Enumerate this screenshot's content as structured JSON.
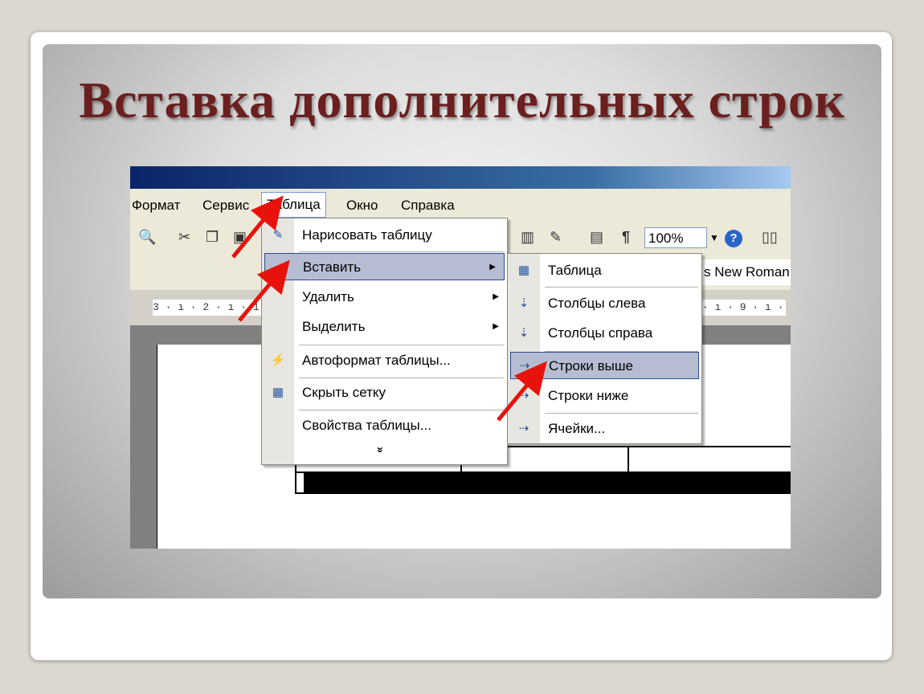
{
  "slide": {
    "title": "Вставка дополнительных строк"
  },
  "menubar": {
    "items": [
      "Формат",
      "Сервис",
      "Таблица",
      "Окно",
      "Справка"
    ]
  },
  "toolbar": {
    "zoom": "100%",
    "pilcrow": "¶",
    "help": "?"
  },
  "format_bar": {
    "font": "s New Roman"
  },
  "ruler": {
    "left_text": "3 · ı · 2 · ı · 1",
    "right_text": "· ı · 9 · ı ·"
  },
  "table_menu": {
    "items": [
      {
        "label": "Нарисовать таблицу",
        "icon": "pencil-table-icon",
        "submenu": false
      },
      {
        "label": "Вставить",
        "icon": "",
        "submenu": true,
        "highlighted": true
      },
      {
        "label": "Удалить",
        "icon": "",
        "submenu": true
      },
      {
        "label": "Выделить",
        "icon": "",
        "submenu": true
      },
      {
        "label": "Автоформат таблицы...",
        "icon": "autoformat-icon",
        "submenu": false
      },
      {
        "label": "Скрыть сетку",
        "icon": "grid-icon",
        "submenu": false
      },
      {
        "label": "Свойства таблицы...",
        "icon": "",
        "submenu": false
      }
    ],
    "expand": "»"
  },
  "insert_submenu": {
    "items": [
      {
        "label": "Таблица",
        "icon": "table-icon"
      },
      {
        "label": "Столбцы слева",
        "icon": "columns-left-icon"
      },
      {
        "label": "Столбцы справа",
        "icon": "columns-right-icon"
      },
      {
        "label": "Строки выше",
        "icon": "rows-above-icon",
        "highlighted": true
      },
      {
        "label": "Строки ниже",
        "icon": "rows-below-icon"
      },
      {
        "label": "Ячейки...",
        "icon": "cells-icon"
      }
    ]
  },
  "colors": {
    "title": "#6b1f1f",
    "highlight": "#b6bdd2",
    "arrow": "#e8120c"
  }
}
